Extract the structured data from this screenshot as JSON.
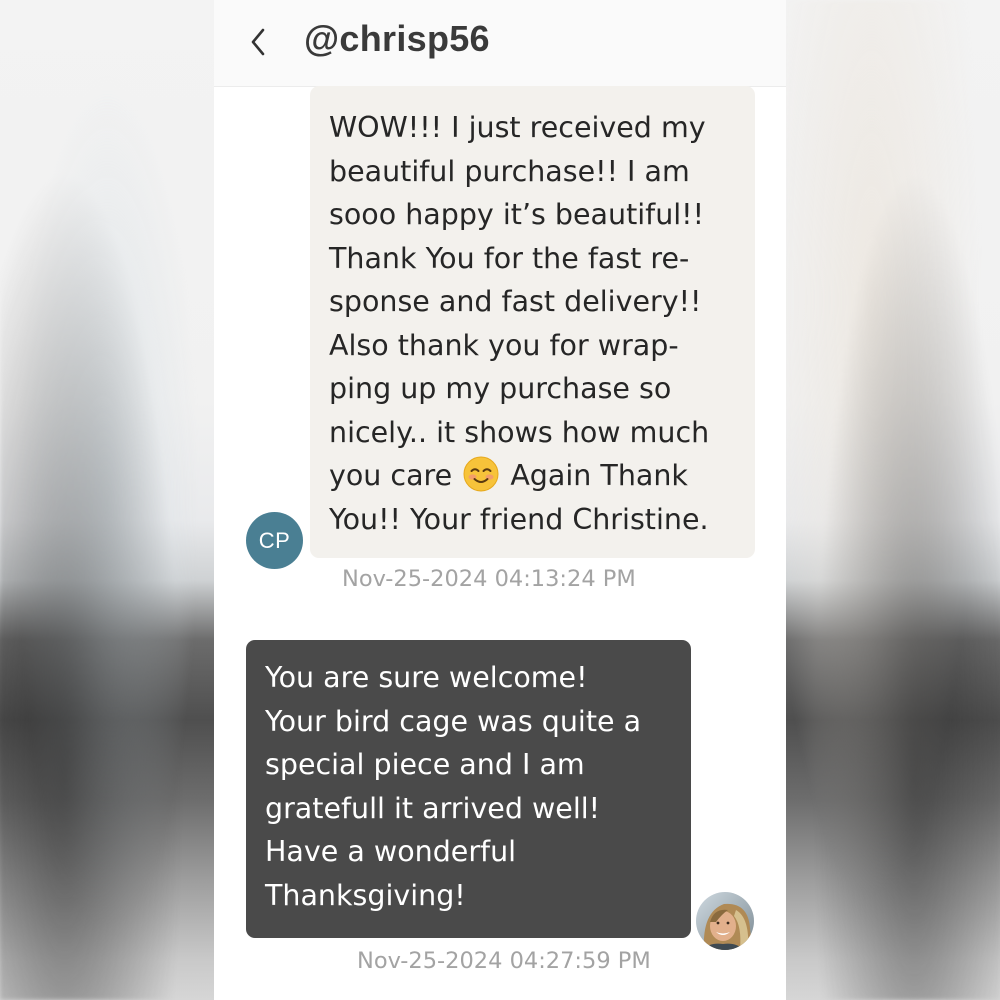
{
  "header": {
    "back_icon": "chevron-left-icon",
    "title": "@chrisp56"
  },
  "messages": [
    {
      "direction": "incoming",
      "sender_initials": "CP",
      "avatar_color": "#4a7f93",
      "bubble_color": "#f3f1ed",
      "lines": [
        "WOW!!! I just received my",
        "beautiful purchase!! I am",
        "sooo happy it’s beautiful!!",
        "Thank You for the fast re-",
        "sponse and fast delivery!!",
        "Also thank you for wrap-",
        "ping up my purchase so",
        "nicely.. it shows how much",
        "you care",
        "Again Thank",
        "You!! Your friend Christine."
      ],
      "emoji": "smiling-face-emoji",
      "timestamp": "Nov-25-2024 04:13:24 PM"
    },
    {
      "direction": "outgoing",
      "avatar": "user-photo-avatar",
      "bubble_color": "#4a4a4a",
      "lines": [
        "You are sure welcome!",
        "Your bird cage was quite a",
        "special piece and I am",
        "gratefull it arrived well!",
        "Have a wonderful",
        "Thanksgiving!"
      ],
      "timestamp": "Nov-25-2024 04:27:59 PM"
    }
  ]
}
